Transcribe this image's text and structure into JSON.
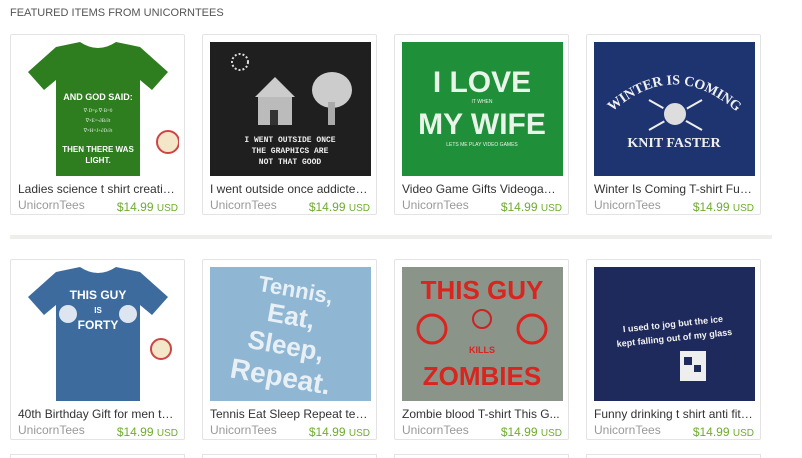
{
  "section": {
    "title": "FEATURED ITEMS FROM UNICORNTEES"
  },
  "items": [
    {
      "title": "Ladies science t shirt creatio...",
      "shop": "UnicornTees",
      "price": "$14.99",
      "currency": "USD",
      "art": {
        "l1": "AND GOD SAID:",
        "l2": "THEN THERE WAS",
        "l3": "LIGHT."
      }
    },
    {
      "title": "I went outside once addicted...",
      "shop": "UnicornTees",
      "price": "$14.99",
      "currency": "USD",
      "art": {
        "l1": "I WENT OUTSIDE ONCE",
        "l2": "THE GRAPHICS ARE",
        "l3": "NOT THAT GOOD"
      }
    },
    {
      "title": "Video Game Gifts Videogam...",
      "shop": "UnicornTees",
      "price": "$14.99",
      "currency": "USD",
      "art": {
        "l1": "I LOVE",
        "l2": "IT WHEN",
        "l3": "MY WIFE",
        "l4": "LETS ME PLAY VIDEO GAMES"
      }
    },
    {
      "title": "Winter Is Coming T-shirt Fun...",
      "shop": "UnicornTees",
      "price": "$14.99",
      "currency": "USD",
      "art": {
        "l1": "WINTER IS COMING",
        "l2": "KNIT FASTER"
      }
    },
    {
      "title": "40th Birthday Gift for men tsh...",
      "shop": "UnicornTees",
      "price": "$14.99",
      "currency": "USD",
      "art": {
        "l1": "THIS GUY",
        "l2": "IS",
        "l3": "FORTY"
      }
    },
    {
      "title": "Tennis Eat Sleep Repeat ten...",
      "shop": "UnicornTees",
      "price": "$14.99",
      "currency": "USD",
      "art": {
        "l1": "Tennis,",
        "l2": "Eat,",
        "l3": "Sleep,",
        "l4": "Repeat."
      }
    },
    {
      "title": "Zombie blood T-shirt This G...",
      "shop": "UnicornTees",
      "price": "$14.99",
      "currency": "USD",
      "art": {
        "l1": "THIS GUY",
        "l2": "KILLS",
        "l3": "ZOMBIES"
      }
    },
    {
      "title": "Funny drinking t shirt anti fitn...",
      "shop": "UnicornTees",
      "price": "$14.99",
      "currency": "USD",
      "art": {
        "l1": "I used to jog but the ice",
        "l2": "kept falling out of my glass"
      }
    }
  ],
  "colors": {
    "price": "#6eac2f",
    "shop": "#999999",
    "title": "#333333"
  }
}
